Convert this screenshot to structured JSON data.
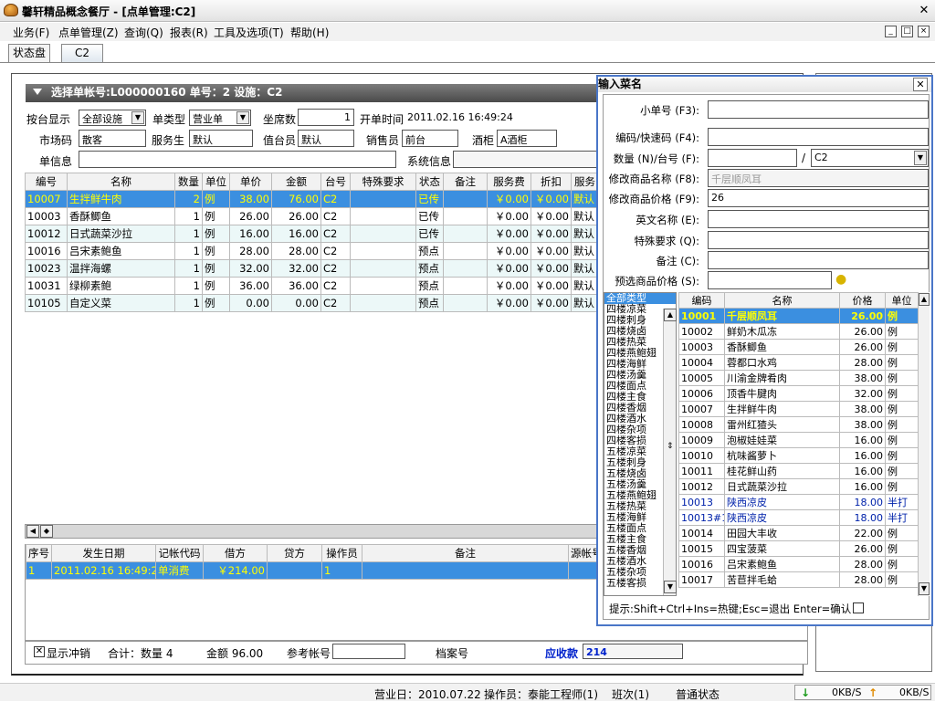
{
  "window": {
    "title": "馨轩精品概念餐厅 - [点单管理:C2]",
    "close": "✕"
  },
  "menubar": [
    "业务(F)",
    "点单管理(Z)",
    "查询(Q)",
    "报表(R)",
    "工具及选项(T)",
    "帮助(H)"
  ],
  "tabs": {
    "status": "状态盘",
    "c2": "C2"
  },
  "order": {
    "section_title": "选择单帐号:L000000160  单号：2  设施：C2",
    "labels": {
      "facility": "按台显示",
      "type": "单类型",
      "seats": "坐席数",
      "open_time": "开单时间",
      "market": "市场码",
      "waiter": "服务生",
      "duty": "值台员",
      "seller": "销售员",
      "bar": "酒柜",
      "info": "单信息",
      "sys_info": "系统信息"
    },
    "values": {
      "facility": "全部设施",
      "type": "营业单",
      "seats": "1",
      "open_time": "2011.02.16 16:49:24",
      "market": "散客",
      "waiter": "默认",
      "duty": "默认",
      "seller": "前台",
      "bar": "A酒柜",
      "info": "",
      "sys_info": ""
    },
    "columns": [
      "编号",
      "名称",
      "数量",
      "单位",
      "单价",
      "金额",
      "台号",
      "特殊要求",
      "状态",
      "备注",
      "服务费",
      "折扣",
      "服务"
    ],
    "rows": [
      [
        "10007",
        "生拌鲜牛肉",
        "2",
        "例",
        "38.00",
        "76.00",
        "C2",
        "",
        "已传",
        "",
        "￥0.00",
        "￥0.00",
        "默认"
      ],
      [
        "10003",
        "香酥鲫鱼",
        "1",
        "例",
        "26.00",
        "26.00",
        "C2",
        "",
        "已传",
        "",
        "￥0.00",
        "￥0.00",
        "默认"
      ],
      [
        "10012",
        "日式蔬菜沙拉",
        "1",
        "例",
        "16.00",
        "16.00",
        "C2",
        "",
        "已传",
        "",
        "￥0.00",
        "￥0.00",
        "默认"
      ],
      [
        "10016",
        "吕宋素鲍鱼",
        "1",
        "例",
        "28.00",
        "28.00",
        "C2",
        "",
        "预点",
        "",
        "￥0.00",
        "￥0.00",
        "默认"
      ],
      [
        "10023",
        "温拌海螺",
        "1",
        "例",
        "32.00",
        "32.00",
        "C2",
        "",
        "预点",
        "",
        "￥0.00",
        "￥0.00",
        "默认"
      ],
      [
        "10031",
        "绿柳素鲍",
        "1",
        "例",
        "36.00",
        "36.00",
        "C2",
        "",
        "预点",
        "",
        "￥0.00",
        "￥0.00",
        "默认"
      ],
      [
        "10105",
        "自定义菜",
        "1",
        "例",
        "0.00",
        "0.00",
        "C2",
        "",
        "预点",
        "",
        "￥0.00",
        "￥0.00",
        "默认"
      ]
    ]
  },
  "ledger": {
    "columns": [
      "序号",
      "发生日期",
      "记帐代码",
      "借方",
      "贷方",
      "操作员",
      "备注",
      "源帐号"
    ],
    "rows": [
      [
        "1",
        "2011.02.16 16:49:26",
        "单消费",
        "￥214.00",
        "",
        "1",
        "",
        ""
      ]
    ]
  },
  "footer": {
    "show_offset": "显示冲销",
    "total_label": "合计：数量 4",
    "amount_label": "金额 96.00",
    "ref_label": "参考帐号",
    "ref_value": "",
    "file_label": "档案号",
    "receivable_label": "应收款",
    "receivable_value": "214"
  },
  "statusbar": {
    "biz_date": "营业日：2010.07.22",
    "operator": "操作员：泰能工程师(1)",
    "shift": "班次(1)",
    "state": "普通状态",
    "down": "0KB/S",
    "up": "0KB/S"
  },
  "dialog": {
    "title": "输入菜名",
    "labels": {
      "sub_no": "小单号 (F3):",
      "code": "编码/快速码 (F4):",
      "qty": "数量 (N)/台号 (F):",
      "mod_name": "修改商品名称 (F8):",
      "mod_price": "修改商品价格 (F9):",
      "en_name": "英文名称 (E):",
      "special": "特殊要求 (Q):",
      "remark": "备注 (C):",
      "preset_price": "预选商品价格 (S):"
    },
    "values": {
      "sub_no": "",
      "code": "",
      "qty": "",
      "table": "C2",
      "mod_name": "千层顺凤耳",
      "mod_price": "26",
      "en_name": "",
      "special": "",
      "remark": "",
      "preset_price": ""
    },
    "categories": [
      "全部类型",
      "四楼凉菜",
      "四楼刺身",
      "四楼烧卤",
      "四楼热菜",
      "四楼燕鲍翅",
      "四楼海鲜",
      "四楼汤羹",
      "四楼面点",
      "四楼主食",
      "四楼香烟",
      "四楼酒水",
      "四楼杂项",
      "四楼客损",
      "五楼凉菜",
      "五楼刺身",
      "五楼烧卤",
      "五楼汤羹",
      "五楼燕鲍翅",
      "五楼热菜",
      "五楼海鲜",
      "五楼面点",
      "五楼主食",
      "五楼香烟",
      "五楼酒水",
      "五楼杂项",
      "五楼客损"
    ],
    "dish_columns": [
      "编码",
      "名称",
      "价格",
      "单位"
    ],
    "dishes": [
      [
        "10001",
        "千层顺凤耳",
        "26.00",
        "例"
      ],
      [
        "10002",
        "鲜奶木瓜冻",
        "26.00",
        "例"
      ],
      [
        "10003",
        "香酥鲫鱼",
        "26.00",
        "例"
      ],
      [
        "10004",
        "蓉都口水鸡",
        "28.00",
        "例"
      ],
      [
        "10005",
        "川渝金牌肴肉",
        "38.00",
        "例"
      ],
      [
        "10006",
        "顶香牛腱肉",
        "32.00",
        "例"
      ],
      [
        "10007",
        "生拌鲜牛肉",
        "38.00",
        "例"
      ],
      [
        "10008",
        "雷州红猹头",
        "38.00",
        "例"
      ],
      [
        "10009",
        "泡椒娃娃菜",
        "16.00",
        "例"
      ],
      [
        "10010",
        "杭味酱萝卜",
        "16.00",
        "例"
      ],
      [
        "10011",
        "桂花鲜山药",
        "16.00",
        "例"
      ],
      [
        "10012",
        "日式蔬菜沙拉",
        "16.00",
        "例"
      ],
      [
        "10013",
        "陕西凉皮",
        "18.00",
        "半打"
      ],
      [
        "10013#1",
        "陕西凉皮",
        "18.00",
        "半打"
      ],
      [
        "10014",
        "田园大丰收",
        "22.00",
        "例"
      ],
      [
        "10015",
        "四宝菠菜",
        "26.00",
        "例"
      ],
      [
        "10016",
        "吕宋素鲍鱼",
        "28.00",
        "例"
      ],
      [
        "10017",
        "苦苣拌毛蛤",
        "28.00",
        "例"
      ]
    ],
    "hint": "提示:Shift+Ctrl+Ins=热键;Esc=退出 Enter=确认"
  }
}
